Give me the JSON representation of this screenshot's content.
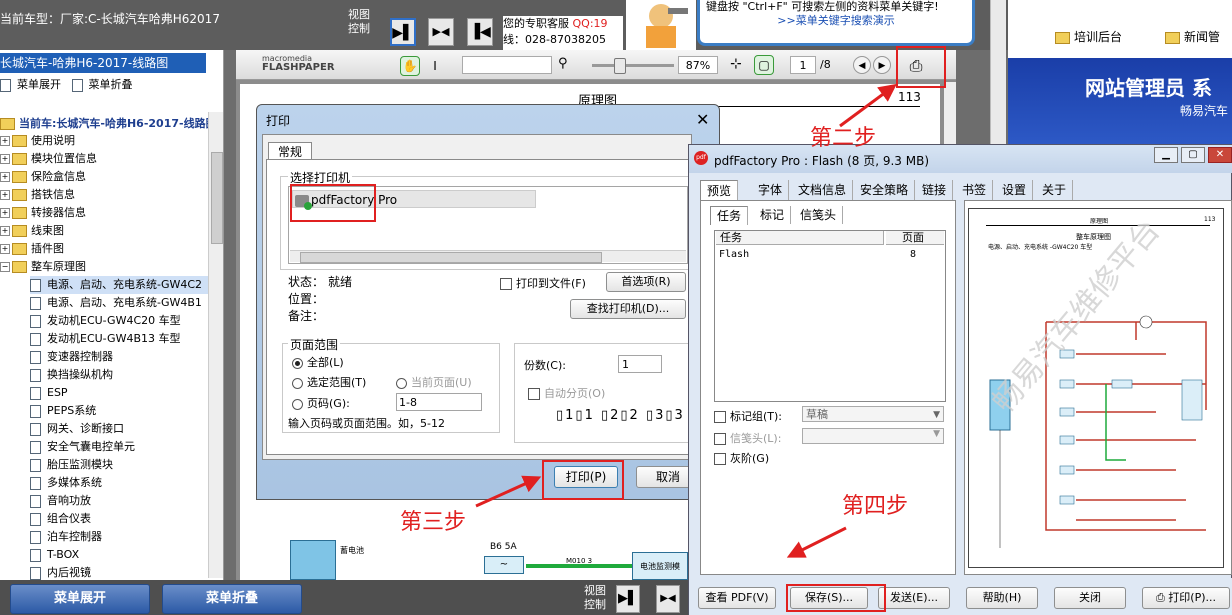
{
  "topbar": {
    "car_model": "当前车型：厂家:C-长城汽车哈弗H62017",
    "view_control": "视图\n控制",
    "contact_line1": "您的专职客服 ",
    "contact_qq": "QQ:19",
    "contact_line2": "线：028-87038205",
    "tip_text": "键盘按 \"Ctrl+F\" 可搜索左侧的资料菜单关键字!",
    "tip_link": ">>菜单关键字搜索演示",
    "nav_training": "培训后台",
    "nav_news": "新闻管",
    "admin_title": "网站管理员 系",
    "admin_sub": "畅易汽车"
  },
  "sidebar": {
    "header": "长城汽车-哈弗H6-2017-线路图",
    "expand": "菜单展开",
    "collapse": "菜单折叠",
    "current": "当前车:长城汽车-哈弗H6-2017-线路图",
    "folders": [
      "使用说明",
      "模块位置信息",
      "保险盒信息",
      "搭铁信息",
      "转接器信息",
      "线束图",
      "插件图",
      "整车原理图"
    ],
    "docs": [
      "电源、启动、充电系统-GW4C2",
      "电源、启动、充电系统-GW4B1",
      "发动机ECU-GW4C20 车型",
      "发动机ECU-GW4B13 车型",
      "变速器控制器",
      "换挡操纵机构",
      "ESP",
      "PEPS系统",
      "网关、诊断接口",
      "安全气囊电控单元",
      "胎压监测模块",
      "多媒体系统",
      "音响功放",
      "组合仪表",
      "泊车控制器",
      "T-BOX",
      "内后视镜"
    ]
  },
  "bottombar": {
    "expand": "菜单展开",
    "collapse": "菜单折叠",
    "view_control": "视图\n控制"
  },
  "flashpaper": {
    "brand_top": "macromedia",
    "brand": "FLASHPAPER",
    "zoom": "87%",
    "page": "1",
    "total": "/8",
    "doc_title": "原理图",
    "doc_page": "113",
    "battery_label": "蓄电池",
    "fuse_label": "B6 5A",
    "wire_label": "M010 3",
    "box_label": "电池监测模"
  },
  "print_dialog": {
    "title": "打印",
    "tab_general": "常规",
    "select_printer": "选择打印机",
    "printer_name": "pdfFactory Pro",
    "status_label": "状态：",
    "status_value": "就绪",
    "location_label": "位置：",
    "comment_label": "备注：",
    "print_to_file": "打印到文件(F)",
    "preferences": "首选项(R)",
    "find_printer": "查找打印机(D)...",
    "page_range": "页面范围",
    "all": "全部(L)",
    "selection": "选定范围(T)",
    "current_page": "当前页面(U)",
    "pages": "页码(G):",
    "pages_value": "1-8",
    "range_hint": "输入页码或页面范围。如，5-12",
    "copies": "份数(C):",
    "copies_value": "1",
    "collate": "自动分页(O)",
    "print_btn": "打印(P)",
    "cancel_btn": "取消"
  },
  "pdffactory": {
    "title": "pdfFactory Pro : Flash (8 页, 9.3 MB)",
    "tabs": [
      "预览",
      "字体",
      "文档信息",
      "安全策略",
      "链接",
      "书签",
      "设置",
      "关于"
    ],
    "subtabs": [
      "任务",
      "标记",
      "信笺头"
    ],
    "col_task": "任务",
    "col_pages": "页面",
    "row_task": "Flash",
    "row_pages": "8",
    "bookmark_label": "标记组(T):",
    "bookmark_value": "草稿",
    "letterhead_label": "信笺头(L):",
    "grayscale_label": "灰阶(G)",
    "btn_view_pdf": "查看 PDF(V)",
    "btn_save": "保存(S)...",
    "btn_send": "发送(E)...",
    "btn_help": "帮助(H)",
    "btn_close": "关闭",
    "btn_print": "打印(P)...",
    "preview_header_left": "原理图",
    "preview_header_right": "113",
    "preview_title": "整车原理图",
    "preview_subtitle": "电源、启动、充电系统 -GW4C20 车型"
  },
  "annotations": {
    "step2": "第二步",
    "step3": "第三步",
    "step4": "第四步",
    "annotation_color": "#e02020"
  },
  "watermark": "畅易汽车维修平台"
}
